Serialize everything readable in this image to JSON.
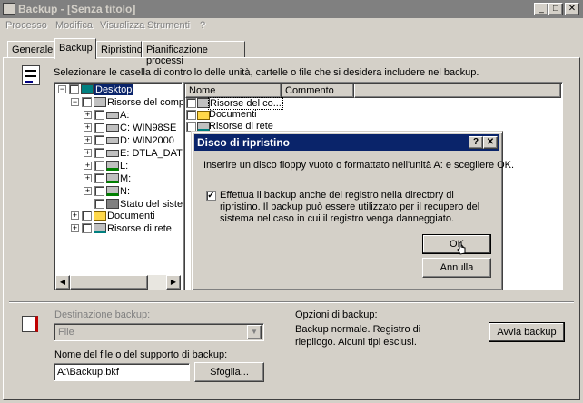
{
  "window": {
    "title": "Backup - [Senza titolo]"
  },
  "menu": [
    "Processo",
    "Modifica",
    "Visualizza",
    "Strumenti",
    "?"
  ],
  "tabs": [
    "Generale",
    "Backup",
    "Ripristino",
    "Pianificazione processi"
  ],
  "backup": {
    "instruction": "Selezionare le casella di controllo delle unità, cartelle o file che si desidera includere nel backup.",
    "tree": [
      {
        "label": "Desktop"
      },
      {
        "label": "Risorse del comp"
      },
      {
        "label": "A:"
      },
      {
        "label": "C: WIN98SE"
      },
      {
        "label": "D: WIN2000"
      },
      {
        "label": "E: DTLA_DAT"
      },
      {
        "label": "L:"
      },
      {
        "label": "M:"
      },
      {
        "label": "N:"
      },
      {
        "label": "Stato del sister"
      },
      {
        "label": "Documenti"
      },
      {
        "label": "Risorse di rete"
      }
    ],
    "list_headers": {
      "name": "Nome",
      "comment": "Commento"
    },
    "list_items": [
      "Risorse del co...",
      "Documenti",
      "Risorse di rete"
    ],
    "destination_label": "Destinazione backup:",
    "destination_value": "File",
    "filename_label": "Nome del file o del supporto di backup:",
    "filename_value": "A:\\Backup.bkf",
    "browse_button": "Sfoglia...",
    "options_label": "Opzioni di backup:",
    "options_text": "Backup normale.  Registro di riepilogo.  Alcuni tipi esclusi.",
    "start_button": "Avvia backup"
  },
  "dialog": {
    "title": "Disco di ripristino",
    "message": "Inserire un disco floppy vuoto o formattato nell'unità A: e scegliere OK.",
    "checkbox_text": "Effettua il backup anche del registro nella directory di ripristino. Il backup può essere utilizzato per il recupero del sistema nel caso in cui il registro venga danneggiato.",
    "ok_button": "OK",
    "cancel_button": "Annulla"
  },
  "colors": {
    "dialog_title": "#0a246a",
    "window_title_inactive": "#808080",
    "face": "#d4d0c8"
  }
}
